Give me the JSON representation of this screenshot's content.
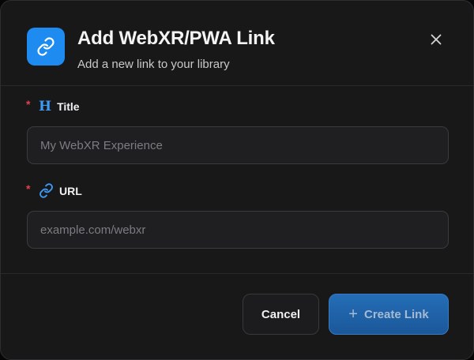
{
  "dialog": {
    "title": "Add WebXR/PWA Link",
    "subtitle": "Add a new link to your library",
    "header_icon": "link-icon",
    "close_icon": "close-icon"
  },
  "fields": {
    "title": {
      "required_mark": "*",
      "icon": "heading-icon",
      "icon_glyph": "H",
      "label": "Title",
      "value": "",
      "placeholder": "My WebXR Experience"
    },
    "url": {
      "required_mark": "*",
      "icon": "link-icon",
      "label": "URL",
      "value": "",
      "placeholder": "example.com/webxr"
    }
  },
  "footer": {
    "cancel_label": "Cancel",
    "create_label": "Create Link",
    "create_icon": "plus-icon",
    "create_icon_glyph": "+"
  },
  "colors": {
    "accent": "#1e8bf0",
    "required": "#e0424b",
    "background": "#181819"
  }
}
